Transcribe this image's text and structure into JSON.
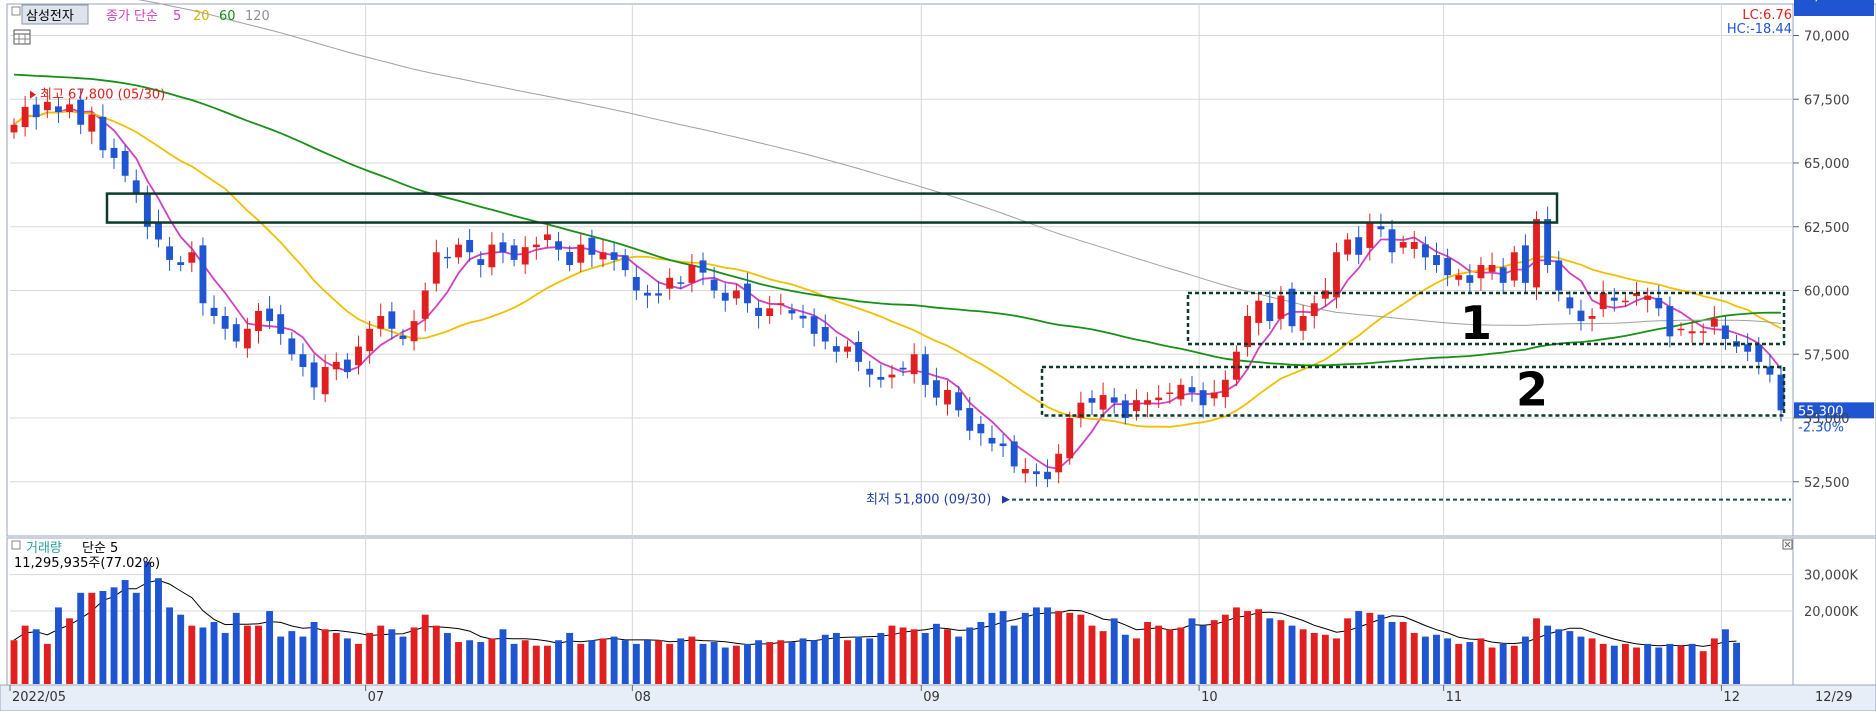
{
  "price_panel": {
    "stock_name": "삼성전자",
    "ma_label": "종가 단순",
    "ma_periods": [
      "5",
      "20",
      "60",
      "120"
    ],
    "ma_colors": [
      "#d040c0",
      "#f0c000",
      "#189018",
      "#a0a0a0"
    ],
    "lc_label": "LC:6.76",
    "hc_label": "HC:-18.44",
    "high_label": "최고 67,800 (05/30)",
    "low_label": "최저 51,800 (09/30)",
    "last_price": "55,300",
    "last_change": "-2.30%",
    "box_1_label": "1",
    "box_2_label": "2"
  },
  "volume_panel": {
    "title": "거래량",
    "ma_label": "단순 5",
    "volume_text": "11,295,935주(77.02%)",
    "last_volume": "11,296K",
    "last_ratio": "77.02%"
  },
  "colors": {
    "up": "#e02020",
    "down": "#1f55d0",
    "grid": "#d8d8d8",
    "axis_bg": "#e8eef8"
  },
  "chart_data": [
    {
      "type": "candlestick",
      "x_ticks": [
        "2022/05",
        "07",
        "08",
        "09",
        "10",
        "11",
        "12"
      ],
      "end_label": "12/29",
      "y_ticks": [
        "52,500",
        "55,000",
        "57,500",
        "60,000",
        "62,500",
        "65,000",
        "67,500",
        "70,000"
      ],
      "ylim": [
        51000,
        71000
      ],
      "approx_closes": [
        66500,
        67200,
        66800,
        67400,
        67000,
        67300,
        66500,
        66900,
        65500,
        65200,
        64500,
        63800,
        62500,
        62000,
        61200,
        61000,
        61500,
        59500,
        59000,
        58500,
        58000,
        58500,
        59200,
        58800,
        58300,
        57500,
        57000,
        56200,
        57000,
        57200,
        56800,
        57800,
        58500,
        59000,
        58500,
        58100,
        58800,
        60000,
        61500,
        61300,
        61800,
        61500,
        61000,
        61800,
        61500,
        61200,
        61700,
        61800,
        62200,
        61600,
        61000,
        61800,
        61400,
        61500,
        61200,
        60800,
        60000,
        59800,
        59800,
        60500,
        60300,
        61000,
        60700,
        60000,
        59600,
        60000,
        59500,
        59000,
        59300,
        59500,
        59100,
        58900,
        58300,
        58000,
        57600,
        57800,
        57200,
        56700,
        56500,
        56700,
        56900,
        57500,
        56300,
        55800,
        56100,
        55300,
        54500,
        54400,
        54000,
        53900,
        53100,
        53000,
        52800,
        52600,
        53600,
        55000,
        55600,
        55600,
        55900,
        55600,
        55000,
        55700,
        55700,
        55800,
        56000,
        56300,
        56000,
        55500,
        56000,
        56500,
        57600,
        59000,
        59600,
        58800,
        59800,
        58600,
        59000,
        59500,
        60000,
        61500,
        62000,
        61400,
        62700,
        62400,
        61500,
        61900,
        61900,
        61300,
        61000,
        60600,
        60600,
        60300,
        61000,
        61000,
        60300,
        61500,
        60300,
        62800,
        61000,
        60000,
        59300,
        58800,
        59000,
        59900,
        59600,
        59600,
        59900,
        59800,
        59300,
        58200,
        58500,
        58400,
        58400,
        58900,
        58100,
        57800,
        57600,
        57200,
        56700,
        55300
      ],
      "series": [
        {
          "name": "5",
          "color": "#d040c0"
        },
        {
          "name": "20",
          "color": "#f0c000"
        },
        {
          "name": "60",
          "color": "#189018"
        },
        {
          "name": "120",
          "color": "#a0a0a0"
        }
      ],
      "annotations": [
        {
          "label": "최고 67,800 (05/30)",
          "value": 67800
        },
        {
          "label": "최저 51,800 (09/30)",
          "value": 51800
        },
        {
          "label": "1",
          "range": [
            57900,
            59900
          ]
        },
        {
          "label": "2",
          "range": [
            55100,
            57000
          ]
        }
      ]
    },
    {
      "type": "bar",
      "title": "거래량",
      "y_ticks": [
        "30,000K",
        "20,000K"
      ],
      "approx_volumes_k": [
        12000,
        16000,
        15000,
        11000,
        21000,
        18000,
        25000,
        25000,
        25500,
        26500,
        28500,
        25000,
        33500,
        29000,
        21000,
        19000,
        16000,
        15500,
        17000,
        14000,
        19500,
        16000,
        16000,
        20000,
        13000,
        14500,
        13000,
        17000,
        15000,
        14000,
        12500,
        11000,
        14000,
        16000,
        15000,
        13000,
        15500,
        19000,
        16000,
        14000,
        11500,
        12000,
        11500,
        12500,
        15000,
        11000,
        12000,
        10500,
        10500,
        12000,
        14000,
        11000,
        12000,
        12500,
        13000,
        12000,
        11000,
        12000,
        12000,
        11000,
        12500,
        13000,
        11000,
        11500,
        10000,
        10500,
        11000,
        12000,
        11500,
        12000,
        11500,
        12500,
        12000,
        13500,
        14000,
        12000,
        13000,
        12500,
        14000,
        16000,
        15500,
        15000,
        14000,
        16500,
        15000,
        13000,
        15500,
        17000,
        19500,
        20000,
        16000,
        19500,
        21000,
        21000,
        20000,
        19500,
        19000,
        16000,
        14500,
        18000,
        13500,
        12500,
        17000,
        16000,
        15000,
        15500,
        18000,
        16000,
        17500,
        19000,
        21000,
        20000,
        20500,
        18000,
        17500,
        16000,
        15000,
        14000,
        13500,
        12500,
        18000,
        20000,
        19500,
        19000,
        17000,
        17000,
        14000,
        13000,
        13500,
        12500,
        11000,
        11500,
        12500,
        10000,
        11000,
        10500,
        13000,
        18000,
        16000,
        15000,
        14500,
        13000,
        12500,
        11000,
        10500,
        11000,
        10000,
        11000,
        10000,
        11000,
        10500,
        11000,
        9000,
        12500,
        15000,
        11296
      ]
    }
  ]
}
